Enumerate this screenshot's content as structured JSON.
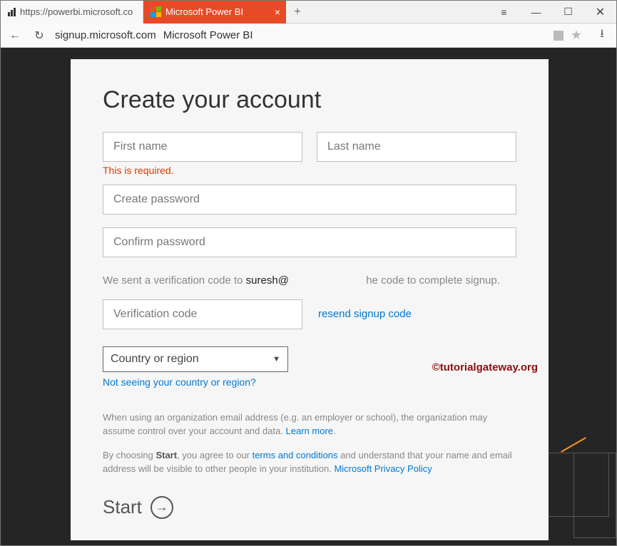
{
  "browser": {
    "tabs": [
      {
        "label": "https://powerbi.microsoft.co"
      },
      {
        "label": "Microsoft Power BI"
      }
    ],
    "url_host": "signup.microsoft.com",
    "url_title": "Microsoft Power BI"
  },
  "page": {
    "heading": "Create your account",
    "first_name_placeholder": "First name",
    "last_name_placeholder": "Last name",
    "first_name_error": "This is required.",
    "create_password_placeholder": "Create password",
    "confirm_password_placeholder": "Confirm password",
    "verify_text_prefix": "We sent a verification code to ",
    "verify_email": "suresh@",
    "verify_text_suffix": "he code to complete signup.",
    "verification_placeholder": "Verification code",
    "resend_link": "resend signup code",
    "country_placeholder": "Country or region",
    "country_help_link": "Not seeing your country or region?",
    "legal1_text": "When using an organization email address (e.g. an employer or school), the organization may assume control over your account and data. ",
    "legal1_link": "Learn more",
    "legal2_prefix": "By choosing ",
    "legal2_bold": "Start",
    "legal2_mid": ", you agree to our ",
    "legal2_link1": "terms and conditions",
    "legal2_mid2": " and understand that your name and email address will be visible to other people in your institution. ",
    "legal2_link2": "Microsoft Privacy Policy",
    "start_label": "Start",
    "watermark": "©tutorialgateway.org"
  }
}
